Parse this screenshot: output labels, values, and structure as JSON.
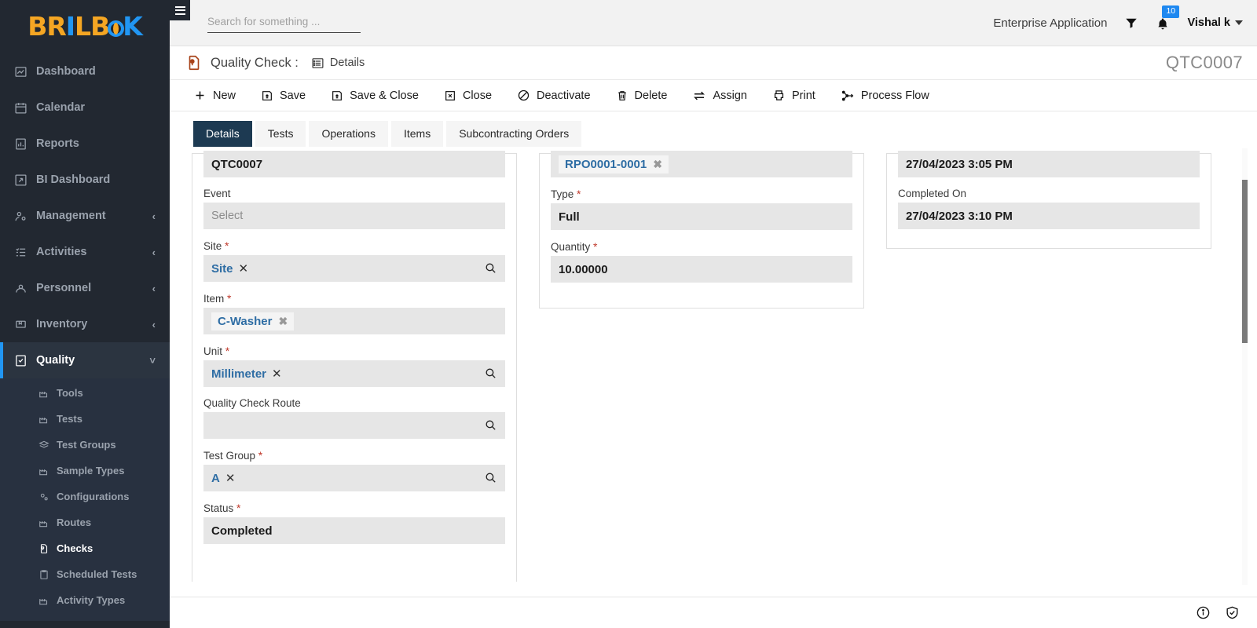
{
  "brand": {
    "name": "BRILBOOK",
    "orange": "#f5a623",
    "blue": "#2196f3"
  },
  "sidebar": {
    "items": [
      {
        "label": "Dashboard",
        "icon": "dashboard-icon",
        "expandable": false
      },
      {
        "label": "Calendar",
        "icon": "calendar-icon",
        "expandable": false
      },
      {
        "label": "Reports",
        "icon": "reports-icon",
        "expandable": false
      },
      {
        "label": "BI Dashboard",
        "icon": "bi-dashboard-icon",
        "expandable": false
      },
      {
        "label": "Management",
        "icon": "management-icon",
        "expandable": true,
        "chevron": "‹"
      },
      {
        "label": "Activities",
        "icon": "activities-icon",
        "expandable": true,
        "chevron": "‹"
      },
      {
        "label": "Personnel",
        "icon": "personnel-icon",
        "expandable": true,
        "chevron": "‹"
      },
      {
        "label": "Inventory",
        "icon": "inventory-icon",
        "expandable": true,
        "chevron": "‹"
      },
      {
        "label": "Quality",
        "icon": "quality-icon",
        "expandable": true,
        "chevron": "˅",
        "active": true
      }
    ],
    "submenu": [
      {
        "label": "Tools",
        "icon": "factory-icon"
      },
      {
        "label": "Tests",
        "icon": "factory-icon"
      },
      {
        "label": "Test Groups",
        "icon": "layers-icon"
      },
      {
        "label": "Sample Types",
        "icon": "factory-icon"
      },
      {
        "label": "Configurations",
        "icon": "gears-icon"
      },
      {
        "label": "Routes",
        "icon": "factory-icon"
      },
      {
        "label": "Checks",
        "icon": "quality-check-icon",
        "active": true
      },
      {
        "label": "Scheduled Tests",
        "icon": "clipboard-icon"
      },
      {
        "label": "Activity Types",
        "icon": "factory-icon"
      }
    ]
  },
  "topbar": {
    "menu_icon": "hamburger-icon",
    "search_placeholder": "Search for something ...",
    "search_value": "",
    "app_label": "Enterprise Application",
    "filter_icon": "funnel-icon",
    "notification_icon": "bell-icon",
    "notification_count": "10",
    "user_name": "Vishal k"
  },
  "titlebar": {
    "entity_icon": "quality-check-doc-icon",
    "entity_title": "Quality Check :",
    "view_icon": "list-details-icon",
    "view_label": "Details",
    "record_id": "QTC0007"
  },
  "toolbar": {
    "buttons": [
      {
        "label": "New",
        "icon": "plus-icon"
      },
      {
        "label": "Save",
        "icon": "save-icon"
      },
      {
        "label": "Save & Close",
        "icon": "save-icon"
      },
      {
        "label": "Close",
        "icon": "close-box-icon"
      },
      {
        "label": "Deactivate",
        "icon": "ban-icon"
      },
      {
        "label": "Delete",
        "icon": "trash-icon"
      },
      {
        "label": "Assign",
        "icon": "assign-arrows-icon"
      },
      {
        "label": "Print",
        "icon": "printer-icon"
      },
      {
        "label": "Process Flow",
        "icon": "process-flow-icon"
      }
    ]
  },
  "tabs": [
    {
      "label": "Details",
      "active": true
    },
    {
      "label": "Tests",
      "active": false
    },
    {
      "label": "Operations",
      "active": false
    },
    {
      "label": "Items",
      "active": false
    },
    {
      "label": "Subcontracting Orders",
      "active": false
    }
  ],
  "form": {
    "left": [
      {
        "label": "",
        "value": "QTC0007",
        "type": "text",
        "required": false
      },
      {
        "label": "Event",
        "value": "Select",
        "type": "placeholder",
        "required": false
      },
      {
        "label": "Site",
        "value": "Site",
        "type": "chip-search",
        "required": true
      },
      {
        "label": "Item",
        "value": "C-Washer",
        "type": "chip-box",
        "required": true
      },
      {
        "label": "Unit",
        "value": "Millimeter",
        "type": "chip-search",
        "required": true
      },
      {
        "label": "Quality Check Route",
        "value": "",
        "type": "search",
        "required": false
      },
      {
        "label": "Test Group",
        "value": "A",
        "type": "chip-search",
        "required": true
      },
      {
        "label": "Status",
        "value": "Completed",
        "type": "text",
        "required": true
      }
    ],
    "middle": [
      {
        "label": "",
        "value": "RPO0001-0001",
        "type": "chip-box",
        "required": false
      },
      {
        "label": "Type",
        "value": "Full",
        "type": "text",
        "required": true
      },
      {
        "label": "Quantity",
        "value": "10.00000",
        "type": "text",
        "required": true
      }
    ],
    "right": [
      {
        "label": "",
        "value": "27/04/2023 3:05 PM",
        "type": "text",
        "required": false
      },
      {
        "label": "Completed On",
        "value": "27/04/2023 3:10 PM",
        "type": "text",
        "required": false
      }
    ]
  },
  "footer": {
    "info_icon": "info-circle-icon",
    "security_icon": "shield-check-icon"
  }
}
